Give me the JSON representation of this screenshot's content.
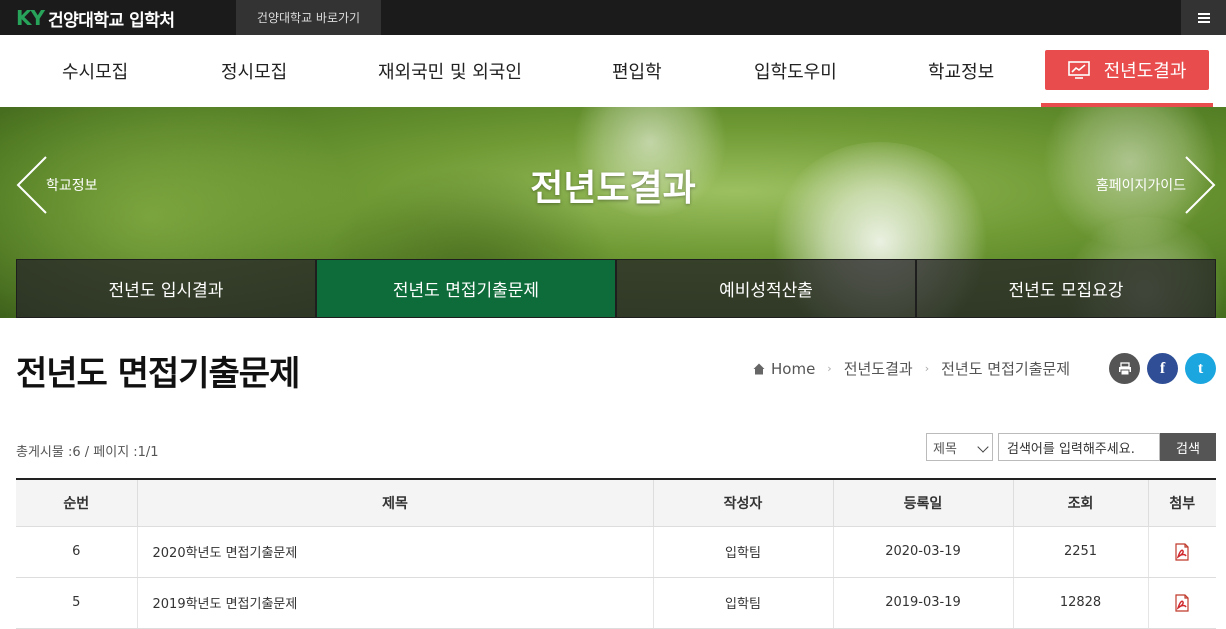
{
  "topbar": {
    "logo_mark": "KY",
    "logo_text": "건양대학교 입학처",
    "shortcut_label": "건양대학교 바로가기"
  },
  "gnb": {
    "items": [
      "수시모집",
      "정시모집",
      "재외국민 및 외국인",
      "편입학",
      "입학도우미",
      "학교정보"
    ],
    "active_label": "전년도결과",
    "accent_color": "#e84c4c"
  },
  "hero": {
    "title": "전년도결과",
    "prev_label": "학교정보",
    "next_label": "홈페이지가이드",
    "subnav": [
      "전년도 입시결과",
      "전년도 면접기출문제",
      "예비성적산출",
      "전년도 모집요강"
    ],
    "subnav_active_index": 1,
    "active_color": "#0e6b3a"
  },
  "page": {
    "title": "전년도 면접기출문제",
    "breadcrumb": [
      "Home",
      "전년도결과",
      "전년도 면접기출문제"
    ]
  },
  "board": {
    "total_text": "총게시물 :6 / 페이지 :1/1",
    "search_select": "제목",
    "search_value": "검색어를 입력해주세요.",
    "search_button": "검색",
    "columns": [
      "순번",
      "제목",
      "작성자",
      "등록일",
      "조회",
      "첨부"
    ],
    "rows": [
      {
        "no": "6",
        "title": "2020학년도 면접기출문제",
        "author": "입학팀",
        "date": "2020-03-19",
        "views": "2251",
        "attach": "pdf-icon"
      },
      {
        "no": "5",
        "title": "2019학년도 면접기출문제",
        "author": "입학팀",
        "date": "2019-03-19",
        "views": "12828",
        "attach": "pdf-icon"
      }
    ]
  }
}
